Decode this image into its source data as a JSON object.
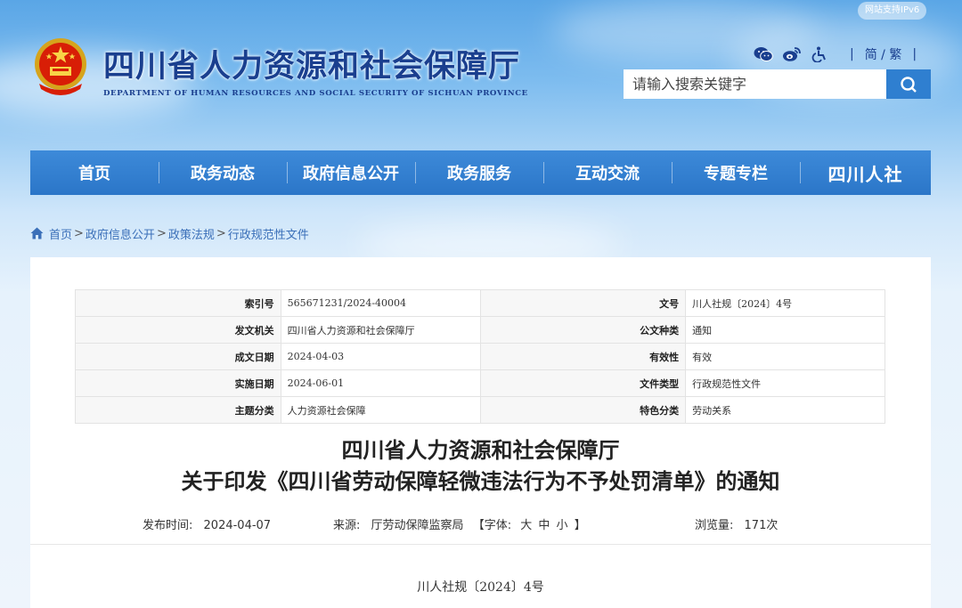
{
  "header": {
    "site_title": "四川省人力资源和社会保障厅",
    "site_title_en": "DEPARTMENT OF HUMAN RESOURCES AND SOCIAL SECURITY OF SICHUAN PROVINCE",
    "ipv6_badge": "网站支持IPv6",
    "lang_toggle": "简 / 繁",
    "search_placeholder": "请输入搜索关键字",
    "icons": [
      "wechat-icon",
      "weibo-icon",
      "accessibility-icon",
      "search-icon"
    ]
  },
  "nav": {
    "items": [
      "首页",
      "政务动态",
      "政府信息公开",
      "政务服务",
      "互动交流",
      "专题专栏"
    ],
    "brand": "四川人社"
  },
  "breadcrumb": {
    "items": [
      "首页",
      "政府信息公开",
      "政策法规",
      "行政规范性文件"
    ],
    "separator": ">"
  },
  "meta": {
    "rows": [
      [
        {
          "k": "索引号",
          "v": "565671231/2024-40004"
        },
        {
          "k": "文号",
          "v": "川人社规〔2024〕4号"
        }
      ],
      [
        {
          "k": "发文机关",
          "v": "四川省人力资源和社会保障厅"
        },
        {
          "k": "公文种类",
          "v": "通知"
        }
      ],
      [
        {
          "k": "成文日期",
          "v": "2024-04-03"
        },
        {
          "k": "有效性",
          "v": "有效"
        }
      ],
      [
        {
          "k": "实施日期",
          "v": "2024-06-01"
        },
        {
          "k": "文件类型",
          "v": "行政规范性文件"
        }
      ],
      [
        {
          "k": "主题分类",
          "v": "人力资源社会保障"
        },
        {
          "k": "特色分类",
          "v": "劳动关系"
        }
      ]
    ]
  },
  "article": {
    "title_line1": "四川省人力资源和社会保障厅",
    "title_line2": "关于印发《四川省劳动保障轻微违法行为不予处罚清单》的通知",
    "publish_label": "发布时间:",
    "publish_date": "2024-04-07",
    "source_label": "来源:",
    "source_value": "厅劳动保障监察局",
    "font_label": "【字体:",
    "font_large": "大",
    "font_medium": "中",
    "font_small": "小",
    "font_end": "】",
    "views_label": "浏览量:",
    "views_value": "171次",
    "doc_number": "川人社规〔2024〕4号"
  },
  "colors": {
    "nav_bg": "#2f7fd0",
    "title_blue": "#1a3f8f",
    "link_blue": "#3a6fb8"
  }
}
